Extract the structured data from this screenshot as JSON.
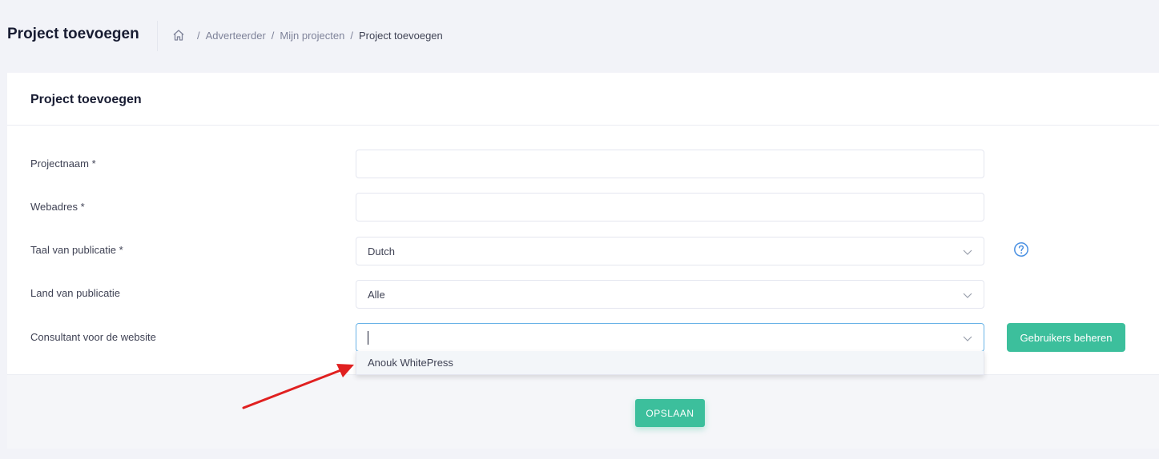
{
  "header": {
    "title": "Project toevoegen",
    "breadcrumb": [
      "Adverteerder",
      "Mijn projecten",
      "Project toevoegen"
    ],
    "separator": "/"
  },
  "card": {
    "title": "Project toevoegen",
    "fields": {
      "project_name": {
        "label": "Projectnaam *",
        "value": ""
      },
      "web_address": {
        "label": "Webadres *",
        "value": ""
      },
      "language": {
        "label": "Taal van publicatie *",
        "value": "Dutch"
      },
      "country": {
        "label": "Land van publicatie",
        "value": "Alle"
      },
      "consultant": {
        "label": "Consultant voor de website",
        "value": ""
      }
    },
    "consultant_options": [
      "Anouk WhitePress"
    ],
    "manage_users_label": "Gebruikers beheren",
    "save_label": "OPSLAAN"
  },
  "colors": {
    "accent": "#3cbf9c",
    "help": "#4a90e2",
    "annotation_arrow": "#e02020"
  }
}
